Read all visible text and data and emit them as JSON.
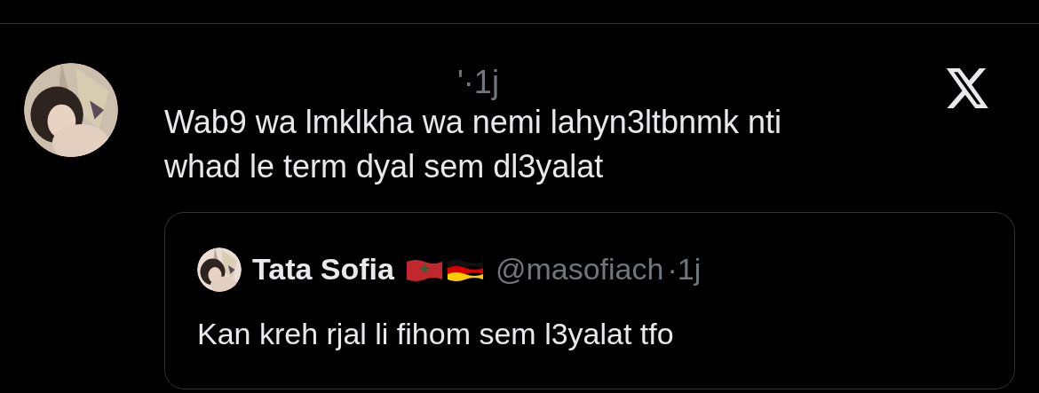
{
  "post": {
    "meta": "'·1j",
    "text": "Wab9 wa lmklkha wa nemi lahyn3ltbnmk nti\nwhad le term dyal sem dl3yalat"
  },
  "quote": {
    "name": "Tata Sofia",
    "flags": [
      {
        "kind": "morocco"
      },
      {
        "kind": "germany"
      }
    ],
    "handle": "@masofiach",
    "time": "·1j",
    "text": "Kan kreh rjal li fihom sem l3yalat tfo"
  }
}
